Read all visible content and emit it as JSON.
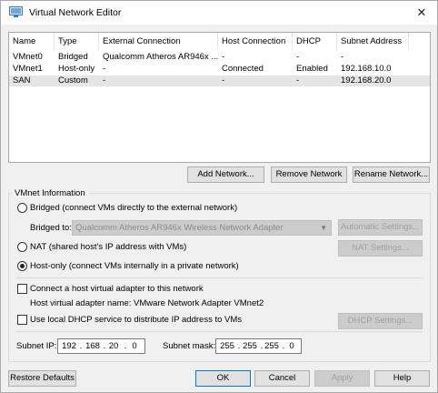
{
  "window": {
    "title": "Virtual Network Editor",
    "close_glyph": "✕"
  },
  "table": {
    "columns": [
      "Name",
      "Type",
      "External Connection",
      "Host Connection",
      "DHCP",
      "Subnet Address"
    ],
    "rows": [
      {
        "name": "VMnet0",
        "type": "Bridged",
        "external": "Qualcomm Atheros AR946x ...",
        "host": "-",
        "dhcp": "-",
        "subnet": "-",
        "selected": false
      },
      {
        "name": "VMnet1",
        "type": "Host-only",
        "external": "-",
        "host": "Connected",
        "dhcp": "Enabled",
        "subnet": "192.168.10.0",
        "selected": false
      },
      {
        "name": "SAN",
        "type": "Custom",
        "external": "-",
        "host": "-",
        "dhcp": "-",
        "subnet": "192.168.20.0",
        "selected": true
      }
    ]
  },
  "table_buttons": {
    "add": "Add Network...",
    "remove": "Remove Network",
    "rename": "Rename Network..."
  },
  "vmnet_info": {
    "legend": "VMnet Information",
    "bridged_label": "Bridged (connect VMs directly to the external network)",
    "bridged_to_label": "Bridged to:",
    "bridged_to_value": "Qualcomm Atheros AR946x Wireless Network Adapter",
    "automatic_settings": "Automatic Settings...",
    "nat_label": "NAT (shared host's IP address with VMs)",
    "nat_settings": "NAT Settings...",
    "hostonly_label": "Host-only (connect VMs internally in a private network)",
    "selected_mode": "hostonly",
    "connect_adapter_label": "Connect a host virtual adapter to this network",
    "connect_adapter_checked": false,
    "adapter_name_label": "Host virtual adapter name: VMware Network Adapter VMnet2",
    "dhcp_label": "Use local DHCP service to distribute IP address to VMs",
    "dhcp_checked": false,
    "dhcp_settings": "DHCP Settings...",
    "subnet_ip_label": "Subnet IP:",
    "subnet_ip": [
      "192",
      "168",
      "20",
      "0"
    ],
    "subnet_mask_label": "Subnet mask:",
    "subnet_mask": [
      "255",
      "255",
      "255",
      "0"
    ]
  },
  "footer": {
    "restore": "Restore Defaults",
    "ok": "OK",
    "cancel": "Cancel",
    "apply": "Apply",
    "help": "Help"
  },
  "icons": {
    "app": "network-editor-icon",
    "close": "close-icon",
    "dropdown": "chevron-down-icon"
  }
}
